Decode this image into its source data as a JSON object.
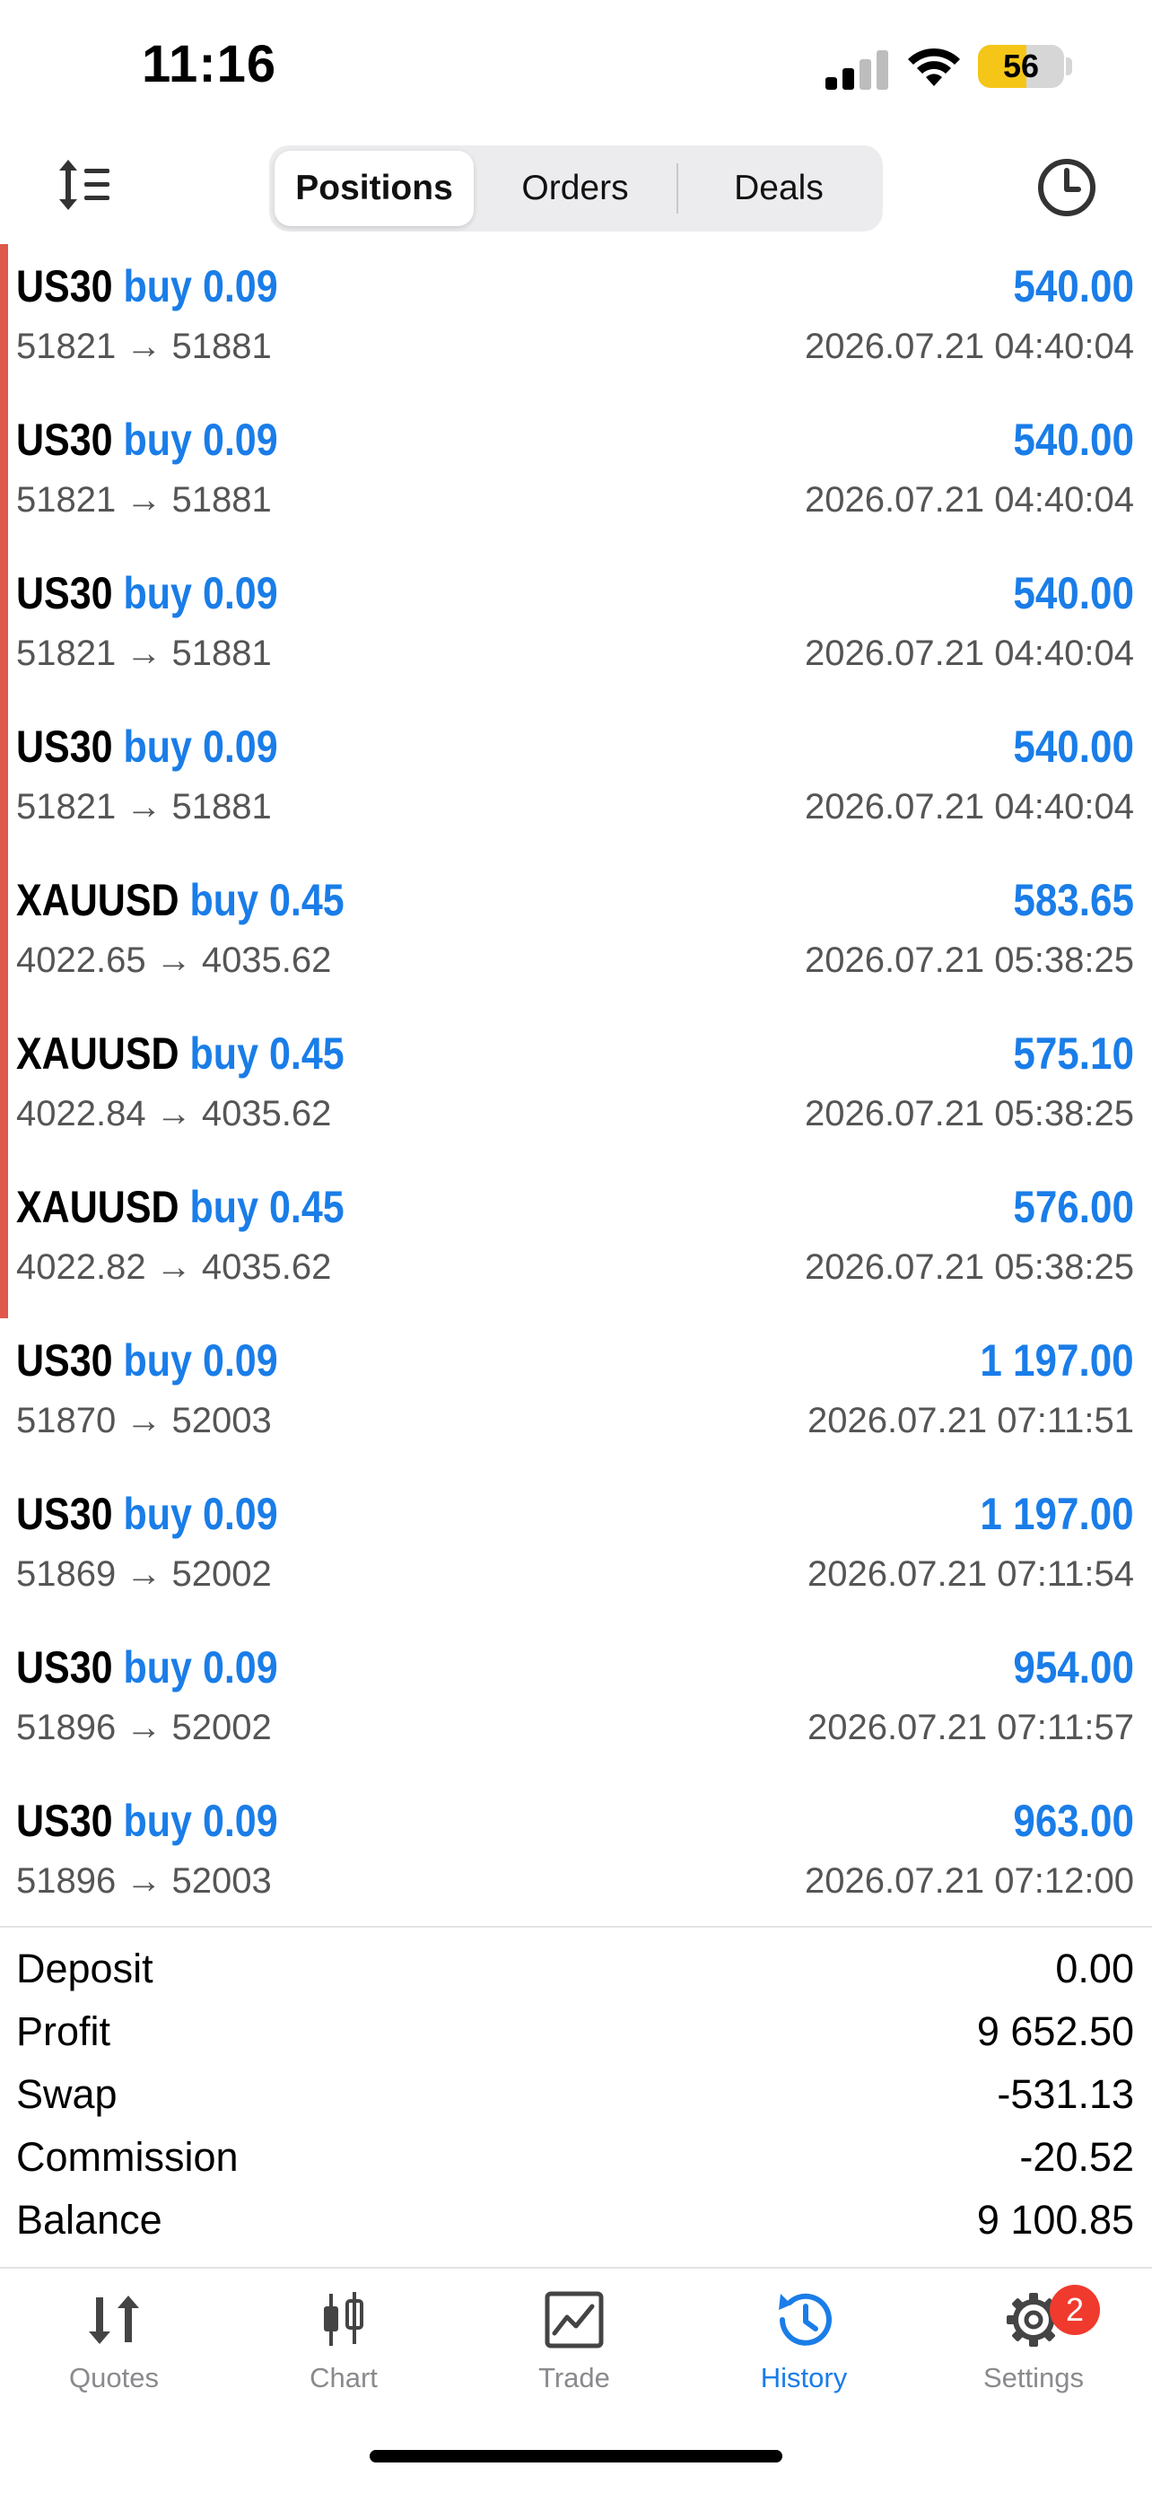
{
  "status_bar": {
    "time": "11:16",
    "battery": "56"
  },
  "tabs": [
    "Positions",
    "Orders",
    "Deals"
  ],
  "positions": [
    {
      "symbol": "US30",
      "direction": "buy",
      "volume": "0.09",
      "prices": "51821 → 51881",
      "profit": "540.00",
      "datetime": "2026.07.21 04:40:04"
    },
    {
      "symbol": "US30",
      "direction": "buy",
      "volume": "0.09",
      "prices": "51821 → 51881",
      "profit": "540.00",
      "datetime": "2026.07.21 04:40:04"
    },
    {
      "symbol": "US30",
      "direction": "buy",
      "volume": "0.09",
      "prices": "51821 → 51881",
      "profit": "540.00",
      "datetime": "2026.07.21 04:40:04"
    },
    {
      "symbol": "US30",
      "direction": "buy",
      "volume": "0.09",
      "prices": "51821 → 51881",
      "profit": "540.00",
      "datetime": "2026.07.21 04:40:04"
    },
    {
      "symbol": "XAUUSD",
      "direction": "buy",
      "volume": "0.45",
      "prices": "4022.65 → 4035.62",
      "profit": "583.65",
      "datetime": "2026.07.21 05:38:25"
    },
    {
      "symbol": "XAUUSD",
      "direction": "buy",
      "volume": "0.45",
      "prices": "4022.84 → 4035.62",
      "profit": "575.10",
      "datetime": "2026.07.21 05:38:25"
    },
    {
      "symbol": "XAUUSD",
      "direction": "buy",
      "volume": "0.45",
      "prices": "4022.82 → 4035.62",
      "profit": "576.00",
      "datetime": "2026.07.21 05:38:25"
    },
    {
      "symbol": "US30",
      "direction": "buy",
      "volume": "0.09",
      "prices": "51870 → 52003",
      "profit": "1 197.00",
      "datetime": "2026.07.21 07:11:51"
    },
    {
      "symbol": "US30",
      "direction": "buy",
      "volume": "0.09",
      "prices": "51869 → 52002",
      "profit": "1 197.00",
      "datetime": "2026.07.21 07:11:54"
    },
    {
      "symbol": "US30",
      "direction": "buy",
      "volume": "0.09",
      "prices": "51896 → 52002",
      "profit": "954.00",
      "datetime": "2026.07.21 07:11:57"
    },
    {
      "symbol": "US30",
      "direction": "buy",
      "volume": "0.09",
      "prices": "51896 → 52003",
      "profit": "963.00",
      "datetime": "2026.07.21 07:12:00"
    }
  ],
  "summary": [
    {
      "label": "Deposit",
      "value": "0.00"
    },
    {
      "label": "Profit",
      "value": "9 652.50"
    },
    {
      "label": "Swap",
      "value": "-531.13"
    },
    {
      "label": "Commission",
      "value": "-20.52"
    },
    {
      "label": "Balance",
      "value": "9 100.85"
    }
  ],
  "tabbar": [
    {
      "label": "Quotes",
      "icon": "quotes-arrows-icon"
    },
    {
      "label": "Chart",
      "icon": "candlestick-icon"
    },
    {
      "label": "Trade",
      "icon": "trade-chart-icon"
    },
    {
      "label": "History",
      "icon": "history-clock-icon"
    },
    {
      "label": "Settings",
      "icon": "gear-icon",
      "badge": "2"
    }
  ],
  "colors": {
    "accent": "#1a7de8",
    "highlight_bar": "#e0574c",
    "badge": "#f03a2e"
  }
}
